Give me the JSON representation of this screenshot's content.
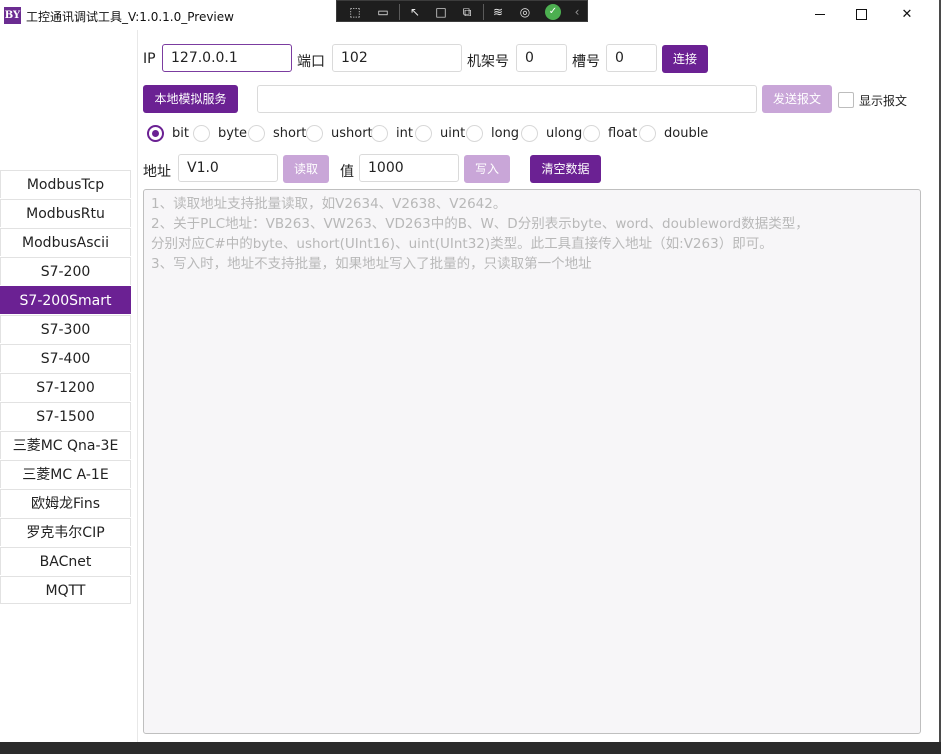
{
  "window": {
    "logo": "BY",
    "title": "工控通讯调试工具_V:1.0.1.0_Preview",
    "close_glyph": "✕"
  },
  "debug_toolbar": {
    "icons": [
      "select-element-icon",
      "video-icon",
      "pointer-icon",
      "frame-icon",
      "display-layout-icon",
      "hot-reload-icon",
      "accessibility-icon",
      "check-icon",
      "collapse-chevron-icon"
    ],
    "check_color": "#4caf50"
  },
  "sidebar": {
    "items": [
      {
        "label": "ModbusTcp"
      },
      {
        "label": "ModbusRtu"
      },
      {
        "label": "ModbusAscii"
      },
      {
        "label": "S7-200"
      },
      {
        "label": "S7-200Smart"
      },
      {
        "label": "S7-300"
      },
      {
        "label": "S7-400"
      },
      {
        "label": "S7-1200"
      },
      {
        "label": "S7-1500"
      },
      {
        "label": "三菱MC Qna-3E"
      },
      {
        "label": "三菱MC A-1E"
      },
      {
        "label": "欧姆龙Fins"
      },
      {
        "label": "罗克韦尔CIP"
      },
      {
        "label": "BACnet"
      },
      {
        "label": "MQTT"
      }
    ],
    "active": "S7-200Smart",
    "accent": "#6b2193"
  },
  "connection": {
    "ip_label": "IP",
    "ip_value": "127.0.0.1",
    "port_label": "端口",
    "port_value": "102",
    "rack_label": "机架号",
    "rack_value": "0",
    "slot_label": "槽号",
    "slot_value": "0",
    "connect_label": "连接"
  },
  "message": {
    "local_sim_label": "本地模拟服务",
    "message_value": "",
    "send_label": "发送报文",
    "show_message_label": "显示报文"
  },
  "types": {
    "options": [
      "bit",
      "byte",
      "short",
      "ushort",
      "int",
      "uint",
      "long",
      "ulong",
      "float",
      "double"
    ],
    "selected": "bit"
  },
  "rw": {
    "address_label": "地址",
    "address_value": "V1.0",
    "read_label": "读取",
    "value_label": "值",
    "value_value": "1000",
    "write_label": "写入",
    "clear_label": "清空数据"
  },
  "log": {
    "lines": [
      "1、读取地址支持批量读取，如V2634、V2638、V2642。",
      "2、关于PLC地址：VB263、VW263、VD263中的B、W、D分别表示byte、word、doubleword数据类型，",
      "分别对应C#中的byte、ushort(UInt16)、uint(UInt32)类型。此工具直接传入地址（如:V263）即可。",
      "3、写入时，地址不支持批量，如果地址写入了批量的，只读取第一个地址"
    ]
  }
}
